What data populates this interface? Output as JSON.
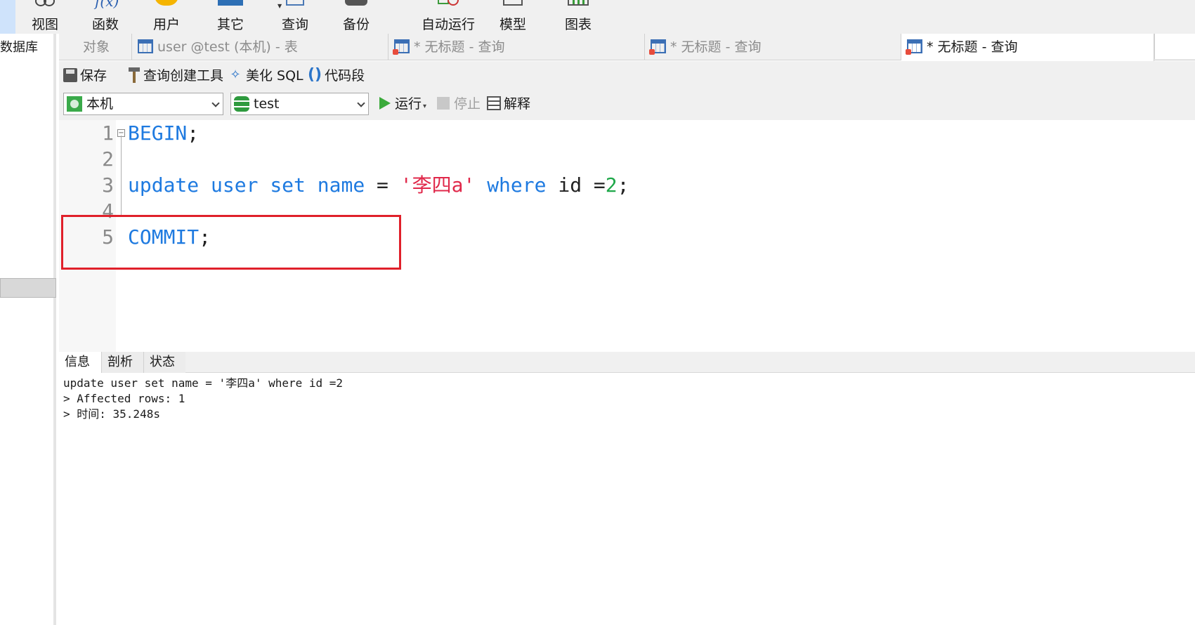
{
  "ribbon": {
    "buttons": [
      {
        "label": "视图",
        "icon": "glasses-icon"
      },
      {
        "label": "函数",
        "icon": "function-icon",
        "glyph": "f(x)"
      },
      {
        "label": "用户",
        "icon": "user-icon"
      },
      {
        "label": "其它",
        "icon": "other-icon"
      },
      {
        "label": "查询",
        "icon": "query-icon"
      },
      {
        "label": "备份",
        "icon": "backup-icon"
      },
      {
        "label": "自动运行",
        "icon": "auto-run-icon"
      },
      {
        "label": "模型",
        "icon": "model-icon"
      },
      {
        "label": "图表",
        "icon": "chart-icon"
      }
    ]
  },
  "left_panel": {
    "title": "数据库"
  },
  "tabs": [
    {
      "label": "对象",
      "active": false
    },
    {
      "label": "user @test (本机) - 表",
      "active": false
    },
    {
      "label": "* 无标题 - 查询",
      "active": false
    },
    {
      "label": "* 无标题 - 查询",
      "active": false
    },
    {
      "label": "* 无标题 - 查询",
      "active": true
    }
  ],
  "toolbar": {
    "save": "保存",
    "query_builder": "查询创建工具",
    "beautify": "美化 SQL",
    "snippet": "代码段",
    "connection": "本机",
    "database": "test",
    "run": "运行",
    "stop": "停止",
    "explain": "解释"
  },
  "editor": {
    "line_numbers": [
      "1",
      "2",
      "3",
      "4",
      "5"
    ],
    "lines": {
      "l1": {
        "kw": "BEGIN",
        "punct": ";"
      },
      "l3": {
        "kw1": "update",
        "kw2": "user",
        "kw3": "set",
        "kw4": "name",
        "op": " = ",
        "str": "'李四a'",
        "kw5": "where",
        "ident": " id =",
        "num": "2",
        "punct": ";"
      },
      "l5": {
        "kw": "COMMIT",
        "punct": ";"
      }
    }
  },
  "results": {
    "tabs": [
      {
        "label": "信息",
        "active": true
      },
      {
        "label": "剖析",
        "active": false
      },
      {
        "label": "状态",
        "active": false
      }
    ],
    "lines": [
      "update user set name = '李四a' where id =2",
      "> Affected rows: 1",
      "> 时间: 35.248s"
    ]
  },
  "colors": {
    "keyword": "#1e7ae0",
    "string": "#e0284a",
    "number": "#1fa84a",
    "highlight_box": "#e0202a"
  }
}
